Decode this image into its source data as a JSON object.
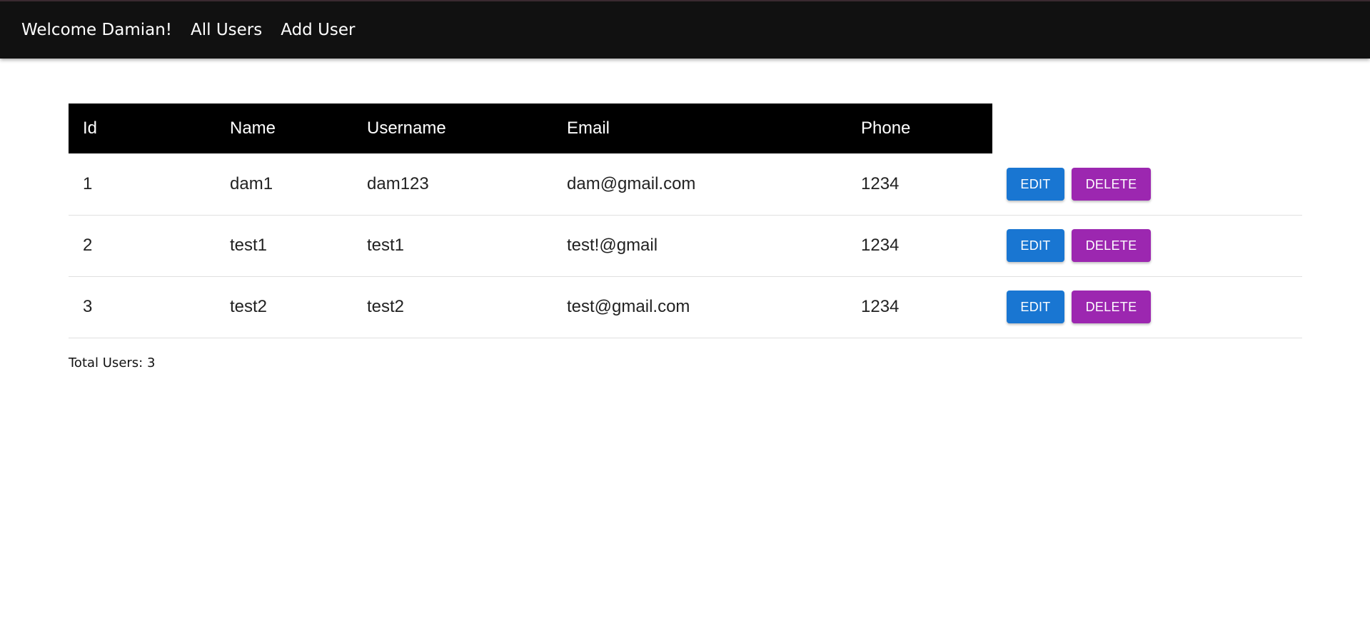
{
  "nav": {
    "welcome": "Welcome Damian!",
    "all_users": "All Users",
    "add_user": "Add User"
  },
  "table": {
    "headers": {
      "id": "Id",
      "name": "Name",
      "username": "Username",
      "email": "Email",
      "phone": "Phone"
    },
    "rows": [
      {
        "id": "1",
        "name": "dam1",
        "username": "dam123",
        "email": "dam@gmail.com",
        "phone": "1234"
      },
      {
        "id": "2",
        "name": "test1",
        "username": "test1",
        "email": "test!@gmail",
        "phone": "1234"
      },
      {
        "id": "3",
        "name": "test2",
        "username": "test2",
        "email": "test@gmail.com",
        "phone": "1234"
      }
    ],
    "edit_label": "EDIT",
    "delete_label": "DELETE"
  },
  "footer": {
    "total_label": "Total Users: 3"
  },
  "colors": {
    "nav_bg": "#111111",
    "header_bg": "#000000",
    "edit_button": "#1976d2",
    "delete_button": "#9c27b0"
  }
}
